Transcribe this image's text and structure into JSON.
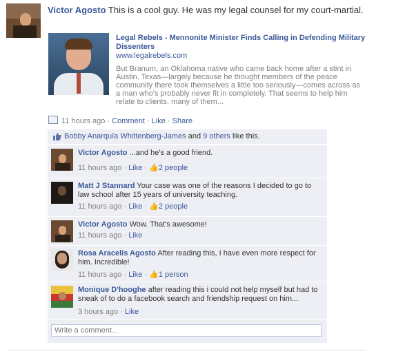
{
  "post": {
    "author": "Victor Agosto",
    "message": "This is a cool guy. He was my legal counsel for my court-martial."
  },
  "share": {
    "title": "Legal Rebels - Mennonite Minister Finds Calling in Defending Military Dissenters",
    "url": "www.legalrebels.com",
    "description": "But Branum, an Oklahoma native who came back home after a stint in Austin, Texas—largely because he thought members of the peace community there took themselves a little too seriously—comes across as a man who's probably never fit in completely. That seems to help him relate to clients, many of them..."
  },
  "meta": {
    "time": "11 hours ago",
    "sep": " · ",
    "comment": "Comment",
    "like": "Like",
    "share": "Share"
  },
  "likes": {
    "name": "Bobby Anarquía Whittenberg-James",
    "and": " and ",
    "others": "9 others",
    "suffix": " like this."
  },
  "comments": [
    {
      "author": "Victor Agosto",
      "text": "...and he's a good friend.",
      "time": "11 hours ago",
      "sep": " · ",
      "like": "Like",
      "likes": "2 people"
    },
    {
      "author": "Matt J Stannard",
      "text": "Your case was one of the reasons I decided to go to law school after 15 years of university teaching.",
      "time": "11 hours ago",
      "sep": " · ",
      "like": "Like",
      "likes": "2 people"
    },
    {
      "author": "Victor Agosto",
      "text": "Wow. That's awesome!",
      "time": "11 hours ago",
      "sep": " · ",
      "like": "Like"
    },
    {
      "author": "Rosa Aracelis Agosto",
      "text": "After reading this, I have even more respect for him. Incredible!",
      "time": "11 hours ago",
      "sep": " · ",
      "like": "Like",
      "likes": "1 person"
    },
    {
      "author": "Monique D'hooghe",
      "text": "after reading this i could not help myself but had to sneak of to do a facebook search and friendship request on him...",
      "time": "3 hours ago",
      "sep": " · ",
      "like": "Like"
    }
  ],
  "composer": {
    "placeholder": "Write a comment..."
  },
  "colors": {
    "link": "#3b5998",
    "panel": "#edeff4",
    "meta": "#808080"
  }
}
